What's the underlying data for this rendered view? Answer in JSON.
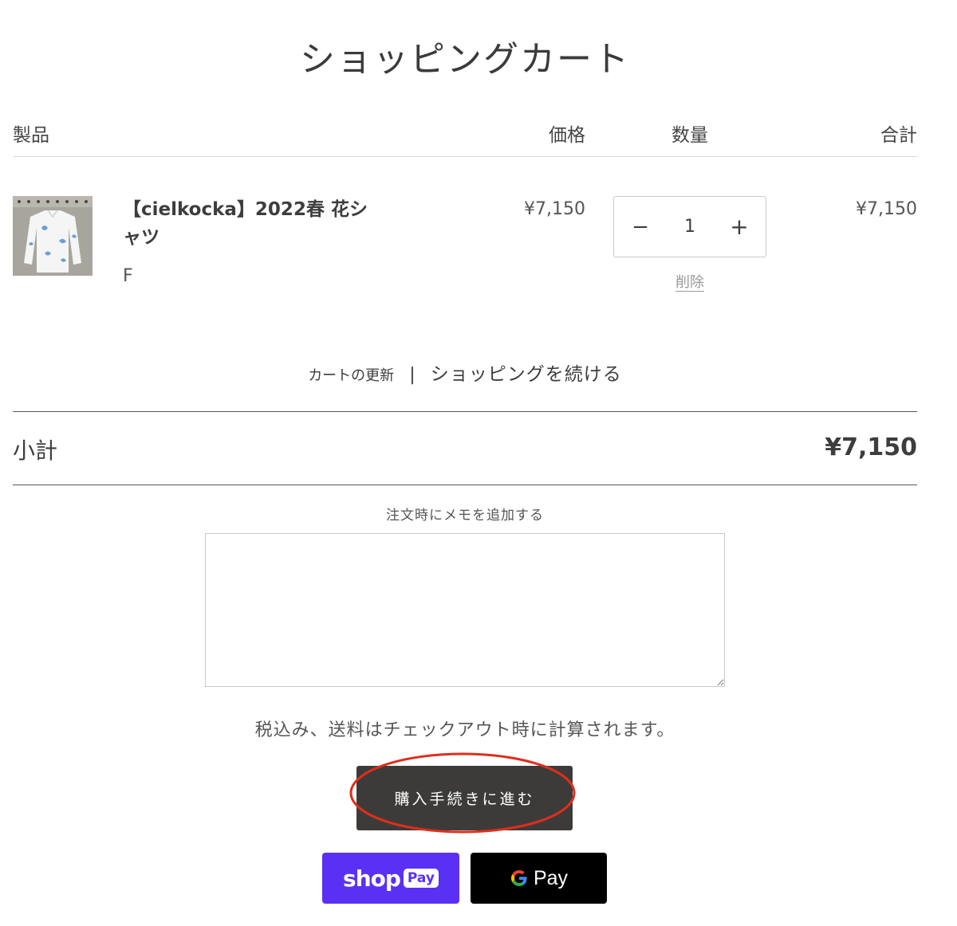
{
  "page": {
    "title": "ショッピングカート"
  },
  "table": {
    "headers": {
      "product": "製品",
      "price": "価格",
      "quantity": "数量",
      "total": "合計"
    }
  },
  "item": {
    "name": "【cielkocka】2022春 花シャツ",
    "variant": "F",
    "price": "¥7,150",
    "quantity": "1",
    "total": "¥7,150",
    "remove_label": "削除",
    "minus_symbol": "−",
    "plus_symbol": "+"
  },
  "cart_links": {
    "update": "カートの更新",
    "separator": "|",
    "continue": "ショッピングを続ける"
  },
  "subtotal": {
    "label": "小計",
    "value": "¥7,150"
  },
  "note": {
    "label": "注文時にメモを追加する",
    "value": ""
  },
  "tax_note": "税込み、送料はチェックアウト時に計算されます。",
  "checkout": {
    "label": "購入手続きに進む"
  },
  "payment": {
    "shop_pay_word": "shop",
    "shop_pay_chip": "Pay",
    "gpay_word": "Pay"
  },
  "colors": {
    "checkout_bg": "#3d3b39",
    "highlight_ellipse": "#e02e1c",
    "shop_pay": "#5a31f4",
    "gpay": "#000000"
  }
}
